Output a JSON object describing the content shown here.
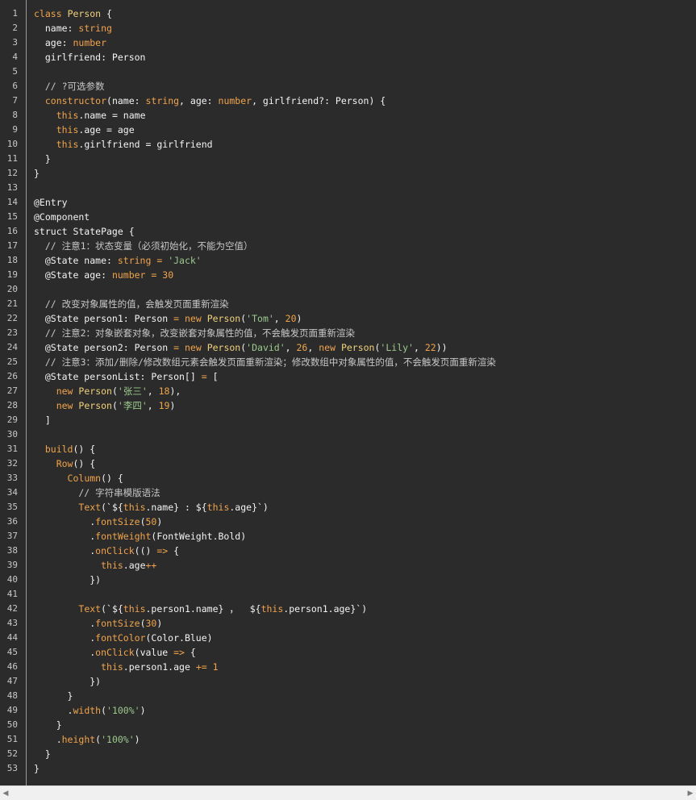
{
  "editor": {
    "language": "ArkTS",
    "colors": {
      "background": "#2b2b2b",
      "keyword": "#f0a44a",
      "class_name": "#f0d17a",
      "string": "#9cc98d",
      "comment": "#c7c7c7",
      "text": "#f3f3f3"
    },
    "lines": [
      {
        "n": "1",
        "tokens": [
          [
            "kw",
            "class"
          ],
          [
            "t",
            " "
          ],
          [
            "ty",
            "Person"
          ],
          [
            "t",
            " {"
          ]
        ]
      },
      {
        "n": "2",
        "tokens": [
          [
            "t",
            "  name: "
          ],
          [
            "tp",
            "string"
          ]
        ]
      },
      {
        "n": "3",
        "tokens": [
          [
            "t",
            "  age: "
          ],
          [
            "pr",
            "number"
          ]
        ]
      },
      {
        "n": "4",
        "tokens": [
          [
            "t",
            "  girlfriend: Person"
          ]
        ]
      },
      {
        "n": "5",
        "tokens": []
      },
      {
        "n": "6",
        "tokens": [
          [
            "cm",
            "  // ?可选参数"
          ]
        ]
      },
      {
        "n": "7",
        "tokens": [
          [
            "t",
            "  "
          ],
          [
            "fn",
            "constructor"
          ],
          [
            "t",
            "(name: "
          ],
          [
            "tp",
            "string"
          ],
          [
            "t",
            ", age: "
          ],
          [
            "pr",
            "number"
          ],
          [
            "t",
            ", girlfriend?: Person) {"
          ]
        ]
      },
      {
        "n": "8",
        "tokens": [
          [
            "t",
            "    "
          ],
          [
            "th",
            "this"
          ],
          [
            "t",
            ".name = name"
          ]
        ]
      },
      {
        "n": "9",
        "tokens": [
          [
            "t",
            "    "
          ],
          [
            "th",
            "this"
          ],
          [
            "t",
            ".age = age"
          ]
        ]
      },
      {
        "n": "10",
        "tokens": [
          [
            "t",
            "    "
          ],
          [
            "th",
            "this"
          ],
          [
            "t",
            ".girlfriend = girlfriend"
          ]
        ]
      },
      {
        "n": "11",
        "tokens": [
          [
            "t",
            "  }"
          ]
        ]
      },
      {
        "n": "12",
        "tokens": [
          [
            "t",
            "}"
          ]
        ]
      },
      {
        "n": "13",
        "tokens": []
      },
      {
        "n": "14",
        "tokens": [
          [
            "t",
            "@Entry"
          ]
        ]
      },
      {
        "n": "15",
        "tokens": [
          [
            "t",
            "@Component"
          ]
        ]
      },
      {
        "n": "16",
        "tokens": [
          [
            "t",
            "struct StatePage {"
          ]
        ]
      },
      {
        "n": "17",
        "tokens": [
          [
            "cm",
            "  // 注意1：状态变量（必须初始化，不能为空值）"
          ]
        ]
      },
      {
        "n": "18",
        "tokens": [
          [
            "t",
            "  @State name: "
          ],
          [
            "tp",
            "string"
          ],
          [
            "op",
            " = "
          ],
          [
            "st",
            "'Jack'"
          ]
        ]
      },
      {
        "n": "19",
        "tokens": [
          [
            "t",
            "  @State age: "
          ],
          [
            "pr",
            "number"
          ],
          [
            "op",
            " = "
          ],
          [
            "nu",
            "30"
          ]
        ]
      },
      {
        "n": "20",
        "tokens": []
      },
      {
        "n": "21",
        "tokens": [
          [
            "cm",
            "  // 改变对象属性的值，会触发页面重新渲染"
          ]
        ]
      },
      {
        "n": "22",
        "tokens": [
          [
            "t",
            "  @State person1: Person "
          ],
          [
            "op",
            "="
          ],
          [
            "t",
            " "
          ],
          [
            "kw",
            "new"
          ],
          [
            "t",
            " "
          ],
          [
            "ty",
            "Person"
          ],
          [
            "t",
            "("
          ],
          [
            "st",
            "'Tom'"
          ],
          [
            "t",
            ", "
          ],
          [
            "nu",
            "20"
          ],
          [
            "t",
            ")"
          ]
        ]
      },
      {
        "n": "23",
        "tokens": [
          [
            "cm",
            "  // 注意2：对象嵌套对象，改变嵌套对象属性的值，不会触发页面重新渲染"
          ]
        ]
      },
      {
        "n": "24",
        "tokens": [
          [
            "t",
            "  @State person2: Person "
          ],
          [
            "op",
            "="
          ],
          [
            "t",
            " "
          ],
          [
            "kw",
            "new"
          ],
          [
            "t",
            " "
          ],
          [
            "ty",
            "Person"
          ],
          [
            "t",
            "("
          ],
          [
            "st",
            "'David'"
          ],
          [
            "t",
            ", "
          ],
          [
            "nu",
            "26"
          ],
          [
            "t",
            ", "
          ],
          [
            "kw",
            "new"
          ],
          [
            "t",
            " "
          ],
          [
            "ty",
            "Person"
          ],
          [
            "t",
            "("
          ],
          [
            "st",
            "'Lily'"
          ],
          [
            "t",
            ", "
          ],
          [
            "nu",
            "22"
          ],
          [
            "t",
            "))"
          ]
        ]
      },
      {
        "n": "25",
        "tokens": [
          [
            "cm",
            "  // 注意3：添加/删除/修改数组元素会触发页面重新渲染；修改数组中对象属性的值，不会触发页面重新渲染"
          ]
        ]
      },
      {
        "n": "26",
        "tokens": [
          [
            "t",
            "  @State personList: Person[] "
          ],
          [
            "op",
            "="
          ],
          [
            "t",
            " ["
          ]
        ]
      },
      {
        "n": "27",
        "tokens": [
          [
            "t",
            "    "
          ],
          [
            "kw",
            "new"
          ],
          [
            "t",
            " "
          ],
          [
            "ty",
            "Person"
          ],
          [
            "t",
            "("
          ],
          [
            "st",
            "'张三'"
          ],
          [
            "t",
            ", "
          ],
          [
            "nu",
            "18"
          ],
          [
            "t",
            "),"
          ]
        ]
      },
      {
        "n": "28",
        "tokens": [
          [
            "t",
            "    "
          ],
          [
            "kw",
            "new"
          ],
          [
            "t",
            " "
          ],
          [
            "ty",
            "Person"
          ],
          [
            "t",
            "("
          ],
          [
            "st",
            "'李四'"
          ],
          [
            "t",
            ", "
          ],
          [
            "nu",
            "19"
          ],
          [
            "t",
            ")"
          ]
        ]
      },
      {
        "n": "29",
        "tokens": [
          [
            "t",
            "  ]"
          ]
        ]
      },
      {
        "n": "30",
        "tokens": []
      },
      {
        "n": "31",
        "tokens": [
          [
            "t",
            "  "
          ],
          [
            "fn",
            "build"
          ],
          [
            "t",
            "() {"
          ]
        ]
      },
      {
        "n": "32",
        "tokens": [
          [
            "t",
            "    "
          ],
          [
            "fn",
            "Row"
          ],
          [
            "t",
            "() {"
          ]
        ]
      },
      {
        "n": "33",
        "tokens": [
          [
            "t",
            "      "
          ],
          [
            "fn",
            "Column"
          ],
          [
            "t",
            "() {"
          ]
        ]
      },
      {
        "n": "34",
        "tokens": [
          [
            "cm",
            "        // 字符串模版语法"
          ]
        ]
      },
      {
        "n": "35",
        "tokens": [
          [
            "t",
            "        "
          ],
          [
            "fn",
            "Text"
          ],
          [
            "t",
            "(`${"
          ],
          [
            "th",
            "this"
          ],
          [
            "t",
            ".name} : ${"
          ],
          [
            "th",
            "this"
          ],
          [
            "t",
            ".age}`)"
          ]
        ]
      },
      {
        "n": "36",
        "tokens": [
          [
            "t",
            "          ."
          ],
          [
            "fn",
            "fontSize"
          ],
          [
            "t",
            "("
          ],
          [
            "nu",
            "50"
          ],
          [
            "t",
            ")"
          ]
        ]
      },
      {
        "n": "37",
        "tokens": [
          [
            "t",
            "          ."
          ],
          [
            "fn",
            "fontWeight"
          ],
          [
            "t",
            "(FontWeight.Bold)"
          ]
        ]
      },
      {
        "n": "38",
        "tokens": [
          [
            "t",
            "          ."
          ],
          [
            "fn",
            "onClick"
          ],
          [
            "t",
            "(() "
          ],
          [
            "op",
            "=>"
          ],
          [
            "t",
            " {"
          ]
        ]
      },
      {
        "n": "39",
        "tokens": [
          [
            "t",
            "            "
          ],
          [
            "th",
            "this"
          ],
          [
            "t",
            ".age"
          ],
          [
            "op",
            "++"
          ]
        ]
      },
      {
        "n": "40",
        "tokens": [
          [
            "t",
            "          })"
          ]
        ]
      },
      {
        "n": "41",
        "tokens": []
      },
      {
        "n": "42",
        "tokens": [
          [
            "t",
            "        "
          ],
          [
            "fn",
            "Text"
          ],
          [
            "t",
            "(`${"
          ],
          [
            "th",
            "this"
          ],
          [
            "t",
            ".person1.name} ，  ${"
          ],
          [
            "th",
            "this"
          ],
          [
            "t",
            ".person1.age}`)"
          ]
        ]
      },
      {
        "n": "43",
        "tokens": [
          [
            "t",
            "          ."
          ],
          [
            "fn",
            "fontSize"
          ],
          [
            "t",
            "("
          ],
          [
            "nu",
            "30"
          ],
          [
            "t",
            ")"
          ]
        ]
      },
      {
        "n": "44",
        "tokens": [
          [
            "t",
            "          ."
          ],
          [
            "fn",
            "fontColor"
          ],
          [
            "t",
            "(Color.Blue)"
          ]
        ]
      },
      {
        "n": "45",
        "tokens": [
          [
            "t",
            "          ."
          ],
          [
            "fn",
            "onClick"
          ],
          [
            "t",
            "(value "
          ],
          [
            "op",
            "=>"
          ],
          [
            "t",
            " {"
          ]
        ]
      },
      {
        "n": "46",
        "tokens": [
          [
            "t",
            "            "
          ],
          [
            "th",
            "this"
          ],
          [
            "t",
            ".person1.age "
          ],
          [
            "op",
            "+="
          ],
          [
            "t",
            " "
          ],
          [
            "nu",
            "1"
          ]
        ]
      },
      {
        "n": "47",
        "tokens": [
          [
            "t",
            "          })"
          ]
        ]
      },
      {
        "n": "48",
        "tokens": [
          [
            "t",
            "      }"
          ]
        ]
      },
      {
        "n": "49",
        "tokens": [
          [
            "t",
            "      ."
          ],
          [
            "fn",
            "width"
          ],
          [
            "t",
            "("
          ],
          [
            "st",
            "'100%'"
          ],
          [
            "t",
            ")"
          ]
        ]
      },
      {
        "n": "50",
        "tokens": [
          [
            "t",
            "    }"
          ]
        ]
      },
      {
        "n": "51",
        "tokens": [
          [
            "t",
            "    ."
          ],
          [
            "fn",
            "height"
          ],
          [
            "t",
            "("
          ],
          [
            "st",
            "'100%'"
          ],
          [
            "t",
            ")"
          ]
        ]
      },
      {
        "n": "52",
        "tokens": [
          [
            "t",
            "  }"
          ]
        ]
      },
      {
        "n": "53",
        "tokens": [
          [
            "t",
            "}"
          ]
        ]
      }
    ]
  },
  "scrollbar": {
    "left_arrow": "◀",
    "right_arrow": "▶"
  }
}
